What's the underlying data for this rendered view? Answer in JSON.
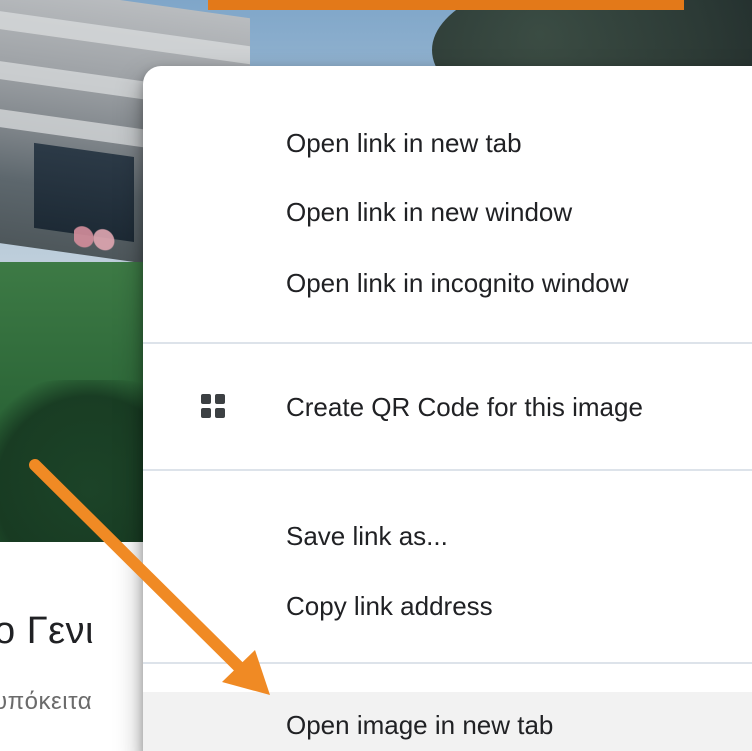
{
  "page": {
    "title_fragment": "ο Γενι",
    "subtitle_fragment": "υπόκειτα"
  },
  "context_menu": {
    "items": [
      {
        "label": "Open link in new tab"
      },
      {
        "label": "Open link in new window"
      },
      {
        "label": "Open link in incognito window"
      },
      {
        "label": "Create QR Code for this image",
        "icon": "qr-code-icon"
      },
      {
        "label": "Save link as..."
      },
      {
        "label": "Copy link address"
      },
      {
        "label": "Open image in new tab"
      }
    ]
  },
  "colors": {
    "highlight_arrow": "#f08a24",
    "menu_background": "#ffffff",
    "menu_text": "#202124",
    "hover_background": "#f2f2f2",
    "banner": "#e37919"
  }
}
